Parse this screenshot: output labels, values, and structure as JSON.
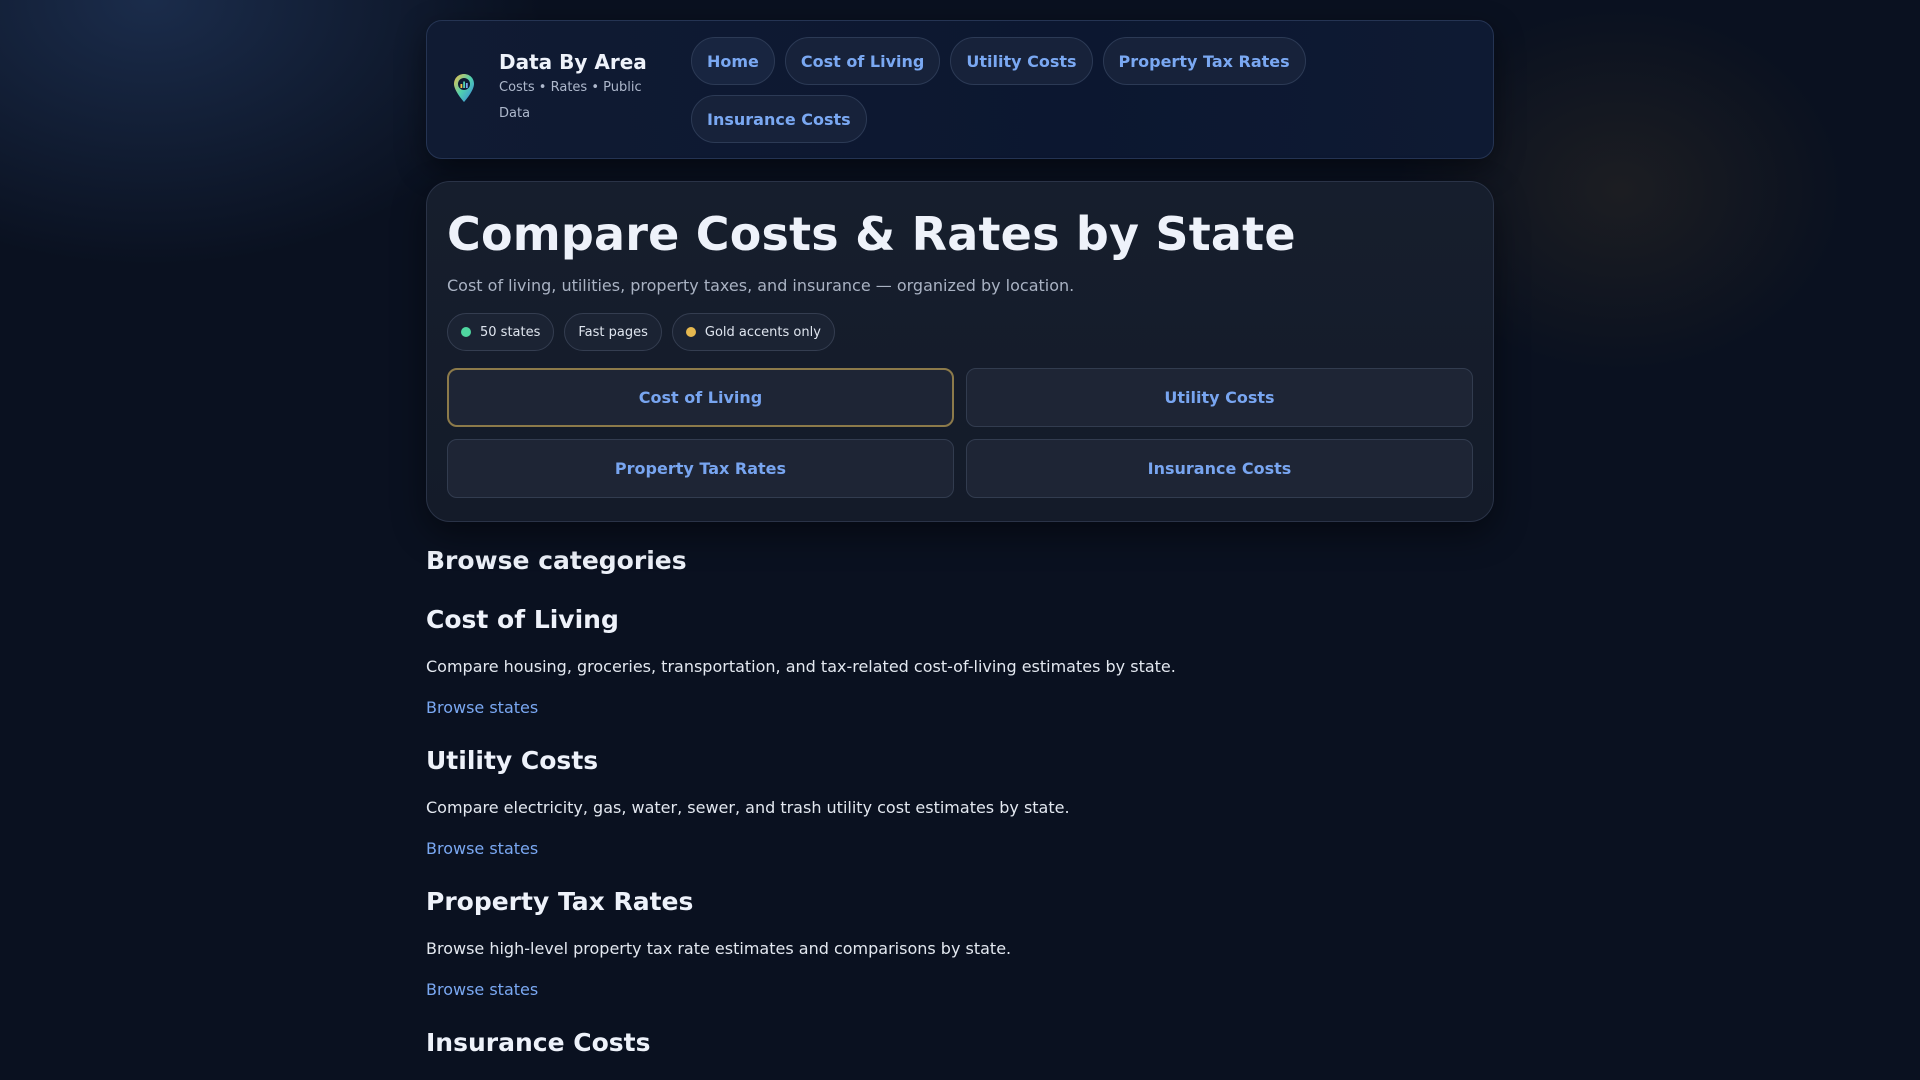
{
  "header": {
    "brand_title": "Data By Area",
    "brand_subtitle": "Costs • Rates • Public Data",
    "nav": [
      "Home",
      "Cost of Living",
      "Utility Costs",
      "Property Tax Rates",
      "Insurance Costs"
    ]
  },
  "hero": {
    "title": "Compare Costs & Rates by State",
    "subtitle": "Cost of living, utilities, property taxes, and insurance — organized by location.",
    "chips": [
      {
        "label": "50 states",
        "dot_color": "#4fd6a0"
      },
      {
        "label": "Fast pages"
      },
      {
        "label": "Gold accents only",
        "dot_color": "#e6b84f"
      }
    ],
    "buttons": [
      "Cost of Living",
      "Utility Costs",
      "Property Tax Rates",
      "Insurance Costs"
    ],
    "active_button": "Cost of Living"
  },
  "content": {
    "heading": "Browse categories",
    "categories": [
      {
        "title": "Cost of Living",
        "description": "Compare housing, groceries, transportation, and tax-related cost-of-living estimates by state.",
        "link": "Browse states"
      },
      {
        "title": "Utility Costs",
        "description": "Compare electricity, gas, water, sewer, and trash utility cost estimates by state.",
        "link": "Browse states"
      },
      {
        "title": "Property Tax Rates",
        "description": "Browse high-level property tax rate estimates and comparisons by state.",
        "link": "Browse states"
      },
      {
        "title": "Insurance Costs"
      }
    ]
  },
  "colors": {
    "accent_blue": "#7aa8f2",
    "gold": "#8c7a4a",
    "background": "#0a1120"
  },
  "icons": {
    "brand": "map-pin-chart-icon"
  }
}
